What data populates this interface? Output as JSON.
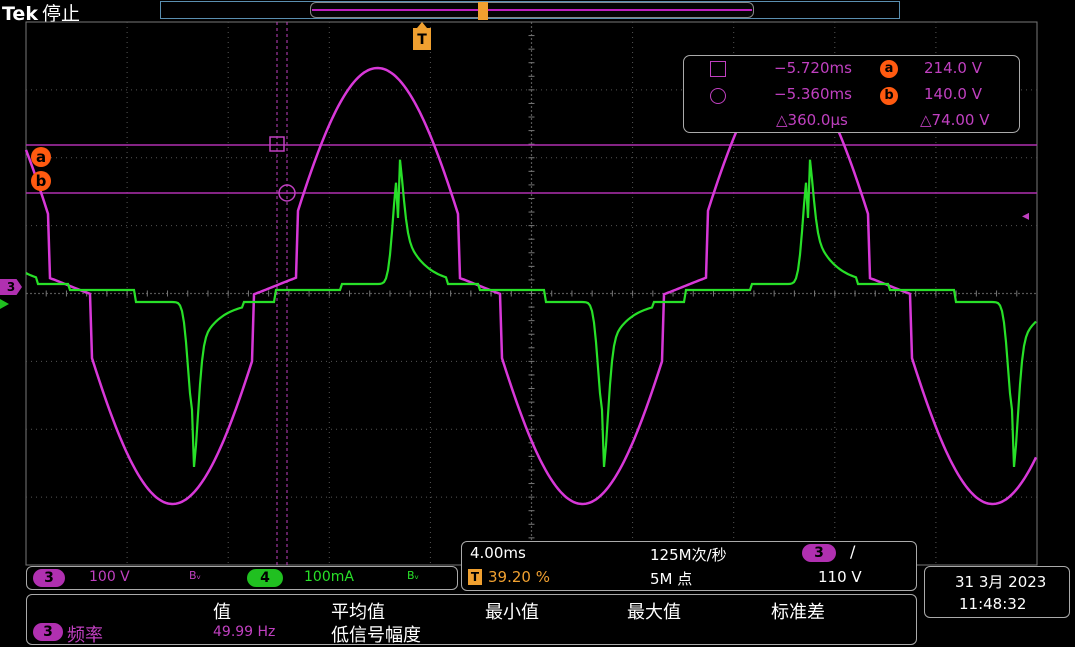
{
  "header": {
    "brand": "Tek",
    "status": "停止"
  },
  "trigger": {
    "marker": "T",
    "color": "#f0a030"
  },
  "ref_markers": {
    "a": "a",
    "b": "b"
  },
  "channel_tags": {
    "ch3": "3",
    "ch4": "4"
  },
  "cursor_readout": {
    "a_time": "−5.720ms",
    "a_marker": "a",
    "a_value": "214.0 V",
    "b_time": "−5.360ms",
    "b_marker": "b",
    "b_value": "140.0 V",
    "delta_time": "△360.0μs",
    "delta_value": "△74.00 V"
  },
  "channels": {
    "ch3": {
      "label": "3",
      "scale": "100 V",
      "color": "#d838d8"
    },
    "ch4": {
      "label": "4",
      "scale": "100mA",
      "color": "#28e028"
    },
    "bw_icon_label": "Bᵥ"
  },
  "acquisition": {
    "timebase": "4.00ms",
    "sample_rate": "125M次/秒",
    "trigger_pos": "39.20 %",
    "record_length": "5M 点",
    "trig_source": "3",
    "trig_slope": "/",
    "trig_level": "110 V"
  },
  "datetime": {
    "date": "31 3月 2023",
    "time": "11:48:32"
  },
  "measurements": {
    "headers": [
      "值",
      "平均值",
      "最小值",
      "最大值",
      "标准差"
    ],
    "row": {
      "source": "3",
      "name": "频率",
      "value": "49.99 Hz",
      "note": "低信号幅度"
    }
  }
}
